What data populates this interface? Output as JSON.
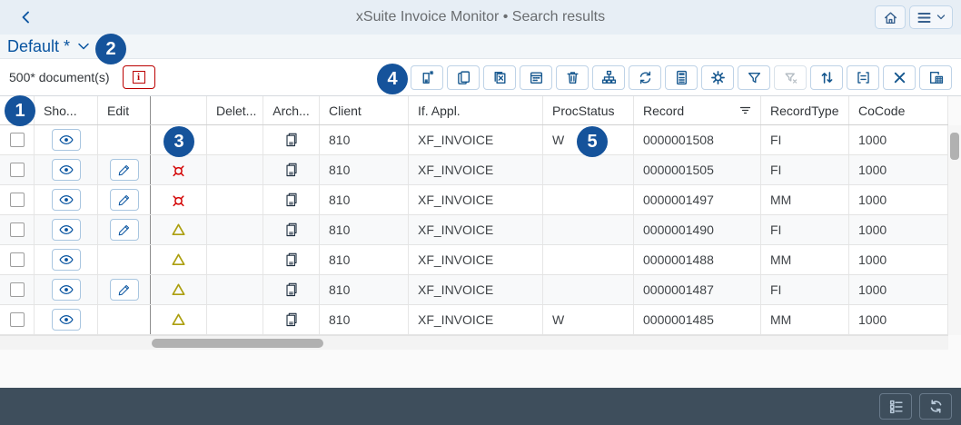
{
  "shell": {
    "title": "xSuite Invoice Monitor • Search results",
    "back_icon": "navigate-back-icon",
    "home_icon": "home-icon",
    "menu_icon": "menu-icon"
  },
  "variant": {
    "label": "Default *"
  },
  "toolbar": {
    "count": "500* document(s)",
    "info_button": "information-icon",
    "buttons": [
      "create-document",
      "copy",
      "remove-document",
      "calendar",
      "delete",
      "hierarchy",
      "refresh",
      "calculator",
      "settings",
      "filter",
      "clear-filter (disabled)",
      "sort",
      "display-format",
      "close",
      "export-to-spreadsheet"
    ]
  },
  "columns": {
    "select": "",
    "show": "Sho...",
    "edit": "Edit",
    "status": "",
    "delete": "Delet...",
    "archive": "Arch...",
    "client": "Client",
    "if_appl": "If. Appl.",
    "proc_status": "ProcStatus",
    "record": "Record",
    "record_type": "RecordType",
    "co_code": "CoCode"
  },
  "rows": [
    {
      "show": true,
      "edit": false,
      "status": "",
      "archived": true,
      "client": "810",
      "if_appl": "XF_INVOICE",
      "proc_status": "W",
      "record": "0000001508",
      "record_type": "FI",
      "co_code": "1000"
    },
    {
      "show": true,
      "edit": true,
      "status": "error",
      "archived": true,
      "client": "810",
      "if_appl": "XF_INVOICE",
      "proc_status": "",
      "record": "0000001505",
      "record_type": "FI",
      "co_code": "1000"
    },
    {
      "show": true,
      "edit": true,
      "status": "error",
      "archived": true,
      "client": "810",
      "if_appl": "XF_INVOICE",
      "proc_status": "",
      "record": "0000001497",
      "record_type": "MM",
      "co_code": "1000"
    },
    {
      "show": true,
      "edit": true,
      "status": "warning",
      "archived": true,
      "client": "810",
      "if_appl": "XF_INVOICE",
      "proc_status": "",
      "record": "0000001490",
      "record_type": "FI",
      "co_code": "1000"
    },
    {
      "show": true,
      "edit": false,
      "status": "warning",
      "archived": true,
      "client": "810",
      "if_appl": "XF_INVOICE",
      "proc_status": "",
      "record": "0000001488",
      "record_type": "MM",
      "co_code": "1000"
    },
    {
      "show": true,
      "edit": true,
      "status": "warning",
      "archived": true,
      "client": "810",
      "if_appl": "XF_INVOICE",
      "proc_status": "",
      "record": "0000001487",
      "record_type": "FI",
      "co_code": "1000"
    },
    {
      "show": true,
      "edit": false,
      "status": "warning",
      "archived": true,
      "client": "810",
      "if_appl": "XF_INVOICE",
      "proc_status": "W",
      "record": "0000001485",
      "record_type": "MM",
      "co_code": "1000"
    }
  ],
  "callouts": [
    {
      "label": "1"
    },
    {
      "label": "2"
    },
    {
      "label": "3"
    },
    {
      "label": "4"
    },
    {
      "label": "5"
    }
  ],
  "footer": {
    "buttons": [
      "legend",
      "refresh"
    ]
  },
  "colors": {
    "accent_blue": "#0854a0",
    "callout_blue": "#15539b",
    "error_red": "#d30000",
    "warning_yellow": "#ac9f0f",
    "info_red": "#bb0000",
    "footer_slate": "#3e4e5c"
  }
}
